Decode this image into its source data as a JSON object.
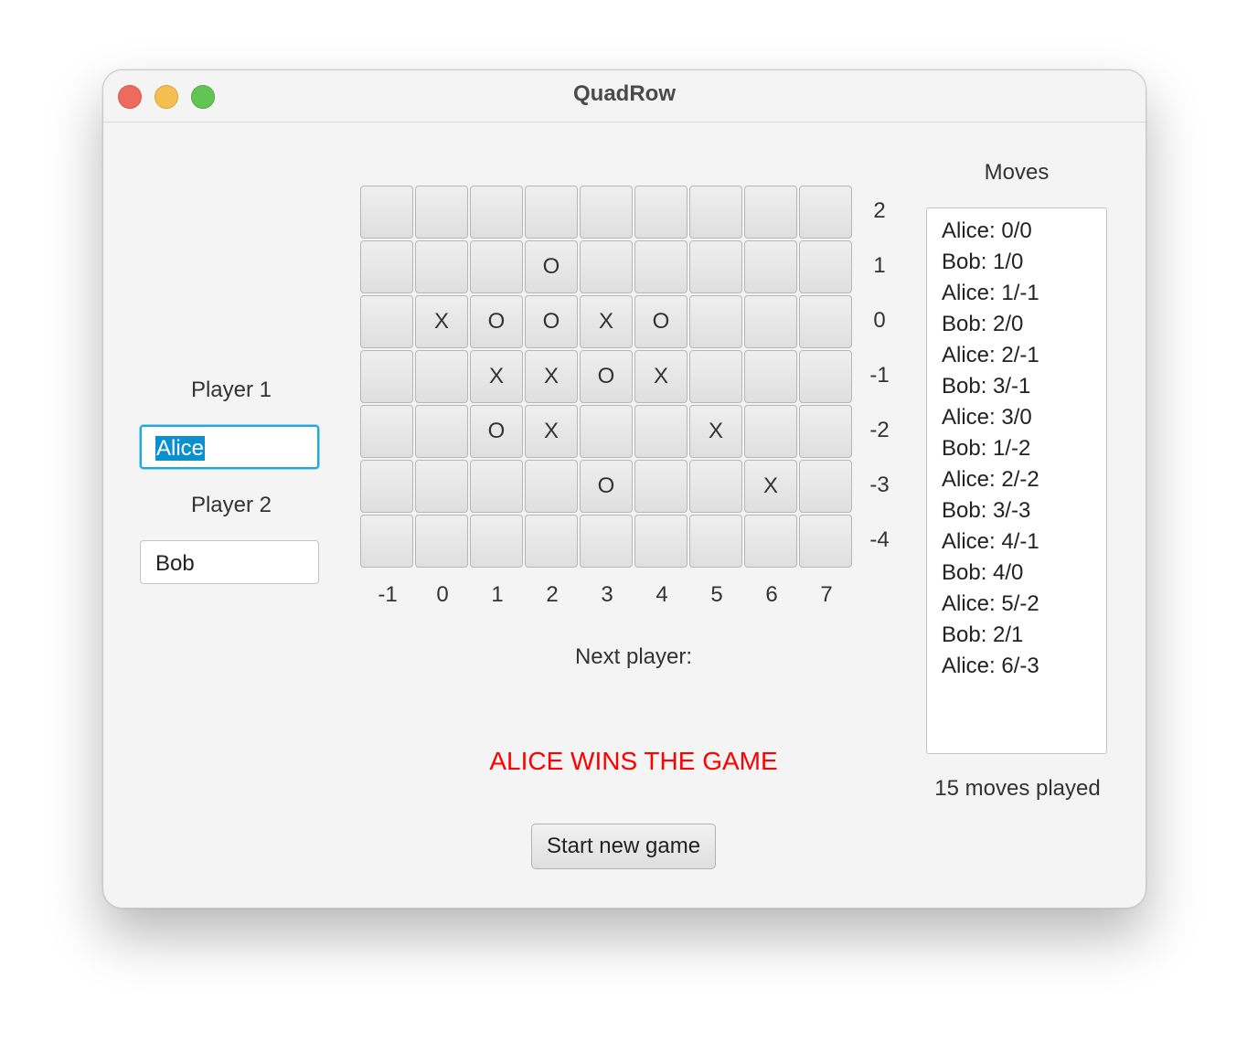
{
  "window": {
    "title": "QuadRow"
  },
  "players": {
    "player1_label": "Player 1",
    "player1_value": "Alice",
    "player2_label": "Player 2",
    "player2_value": "Bob"
  },
  "board": {
    "y_labels": [
      "2",
      "1",
      "0",
      "-1",
      "-2",
      "-3",
      "-4"
    ],
    "x_labels": [
      "-1",
      "0",
      "1",
      "2",
      "3",
      "4",
      "5",
      "6",
      "7"
    ],
    "rows": [
      [
        "",
        "",
        "",
        "",
        "",
        "",
        "",
        "",
        ""
      ],
      [
        "",
        "",
        "",
        "O",
        "",
        "",
        "",
        "",
        ""
      ],
      [
        "",
        "X",
        "O",
        "O",
        "X",
        "O",
        "",
        "",
        ""
      ],
      [
        "",
        "",
        "X",
        "X",
        "O",
        "X",
        "",
        "",
        ""
      ],
      [
        "",
        "",
        "O",
        "X",
        "",
        "",
        "X",
        "",
        ""
      ],
      [
        "",
        "",
        "",
        "",
        "O",
        "",
        "",
        "X",
        ""
      ],
      [
        "",
        "",
        "",
        "",
        "",
        "",
        "",
        "",
        ""
      ]
    ]
  },
  "status": {
    "next_player_label": "Next player:",
    "winner_message": "ALICE WINS THE GAME"
  },
  "moves": {
    "header": "Moves",
    "items": [
      "Alice: 0/0",
      "Bob: 1/0",
      "Alice: 1/-1",
      "Bob: 2/0",
      "Alice: 2/-1",
      "Bob: 3/-1",
      "Alice: 3/0",
      "Bob: 1/-2",
      "Alice: 2/-2",
      "Bob: 3/-3",
      "Alice: 4/-1",
      "Bob: 4/0",
      "Alice: 5/-2",
      "Bob: 2/1",
      "Alice: 6/-3"
    ],
    "count_text": "15 moves played"
  },
  "actions": {
    "new_game_label": "Start new game"
  },
  "colors": {
    "winner": "#ff0000",
    "focus": "#1fa8de",
    "selection": "#0a8fcf"
  }
}
